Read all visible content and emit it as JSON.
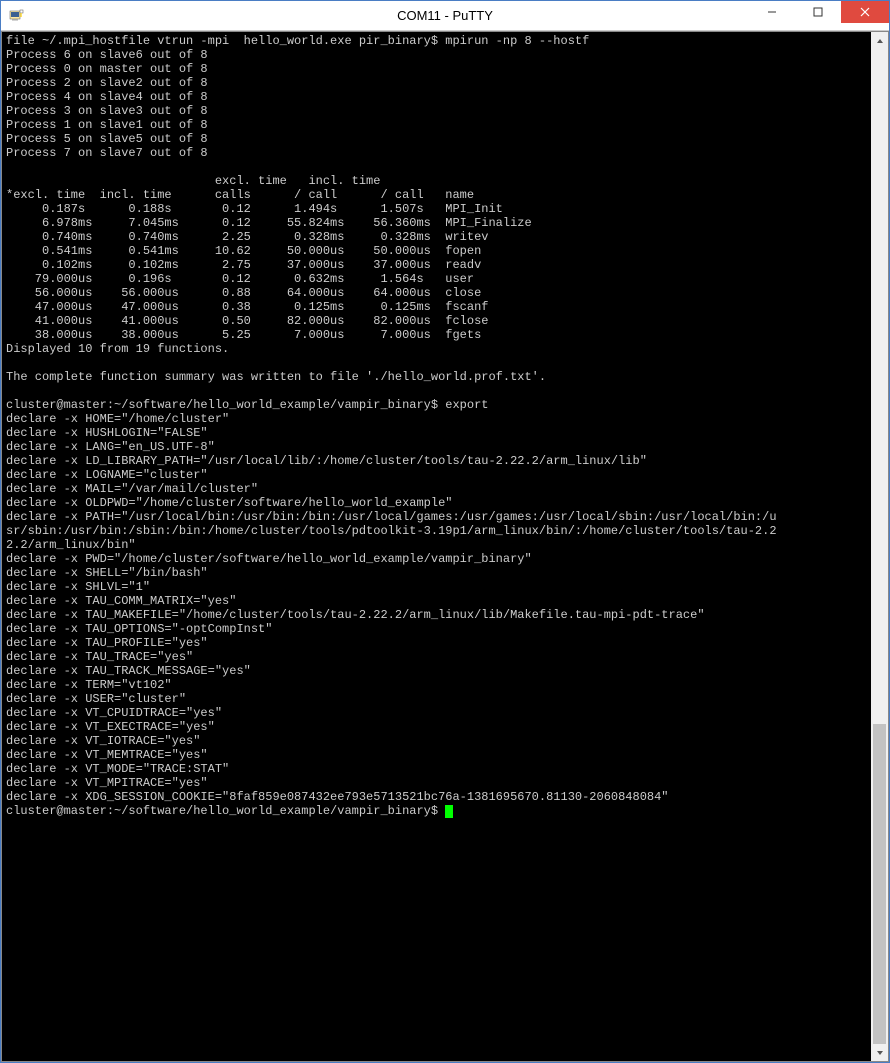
{
  "window": {
    "title": "COM11 - PuTTY",
    "app_icon": "putty-icon"
  },
  "terminal": {
    "lines": [
      "file ~/.mpi_hostfile vtrun -mpi  hello_world.exe pir_binary$ mpirun -np 8 --hostf",
      "Process 6 on slave6 out of 8",
      "Process 0 on master out of 8",
      "Process 2 on slave2 out of 8",
      "Process 4 on slave4 out of 8",
      "Process 3 on slave3 out of 8",
      "Process 1 on slave1 out of 8",
      "Process 5 on slave5 out of 8",
      "Process 7 on slave7 out of 8",
      "",
      "                             excl. time   incl. time",
      "*excl. time  incl. time      calls      / call      / call   name",
      "     0.187s      0.188s       0.12      1.494s      1.507s   MPI_Init",
      "     6.978ms     7.045ms      0.12     55.824ms    56.360ms  MPI_Finalize",
      "     0.740ms     0.740ms      2.25      0.328ms     0.328ms  writev",
      "     0.541ms     0.541ms     10.62     50.000us    50.000us  fopen",
      "     0.102ms     0.102ms      2.75     37.000us    37.000us  readv",
      "    79.000us     0.196s       0.12      0.632ms     1.564s   user",
      "    56.000us    56.000us      0.88     64.000us    64.000us  close",
      "    47.000us    47.000us      0.38      0.125ms     0.125ms  fscanf",
      "    41.000us    41.000us      0.50     82.000us    82.000us  fclose",
      "    38.000us    38.000us      5.25      7.000us     7.000us  fgets",
      "Displayed 10 from 19 functions.",
      "",
      "The complete function summary was written to file './hello_world.prof.txt'.",
      "",
      "cluster@master:~/software/hello_world_example/vampir_binary$ export",
      "declare -x HOME=\"/home/cluster\"",
      "declare -x HUSHLOGIN=\"FALSE\"",
      "declare -x LANG=\"en_US.UTF-8\"",
      "declare -x LD_LIBRARY_PATH=\"/usr/local/lib/:/home/cluster/tools/tau-2.22.2/arm_linux/lib\"",
      "declare -x LOGNAME=\"cluster\"",
      "declare -x MAIL=\"/var/mail/cluster\"",
      "declare -x OLDPWD=\"/home/cluster/software/hello_world_example\"",
      "declare -x PATH=\"/usr/local/bin:/usr/bin:/bin:/usr/local/games:/usr/games:/usr/local/sbin:/usr/local/bin:/u",
      "sr/sbin:/usr/bin:/sbin:/bin:/home/cluster/tools/pdtoolkit-3.19p1/arm_linux/bin/:/home/cluster/tools/tau-2.2",
      "2.2/arm_linux/bin\"",
      "declare -x PWD=\"/home/cluster/software/hello_world_example/vampir_binary\"",
      "declare -x SHELL=\"/bin/bash\"",
      "declare -x SHLVL=\"1\"",
      "declare -x TAU_COMM_MATRIX=\"yes\"",
      "declare -x TAU_MAKEFILE=\"/home/cluster/tools/tau-2.22.2/arm_linux/lib/Makefile.tau-mpi-pdt-trace\"",
      "declare -x TAU_OPTIONS=\"-optCompInst\"",
      "declare -x TAU_PROFILE=\"yes\"",
      "declare -x TAU_TRACE=\"yes\"",
      "declare -x TAU_TRACK_MESSAGE=\"yes\"",
      "declare -x TERM=\"vt102\"",
      "declare -x USER=\"cluster\"",
      "declare -x VT_CPUIDTRACE=\"yes\"",
      "declare -x VT_EXECTRACE=\"yes\"",
      "declare -x VT_IOTRACE=\"yes\"",
      "declare -x VT_MEMTRACE=\"yes\"",
      "declare -x VT_MODE=\"TRACE:STAT\"",
      "declare -x VT_MPITRACE=\"yes\"",
      "declare -x XDG_SESSION_COOKIE=\"8faf859e087432ee793e5713521bc76a-1381695670.81130-2060848084\"",
      "cluster@master:~/software/hello_world_example/vampir_binary$ "
    ]
  }
}
